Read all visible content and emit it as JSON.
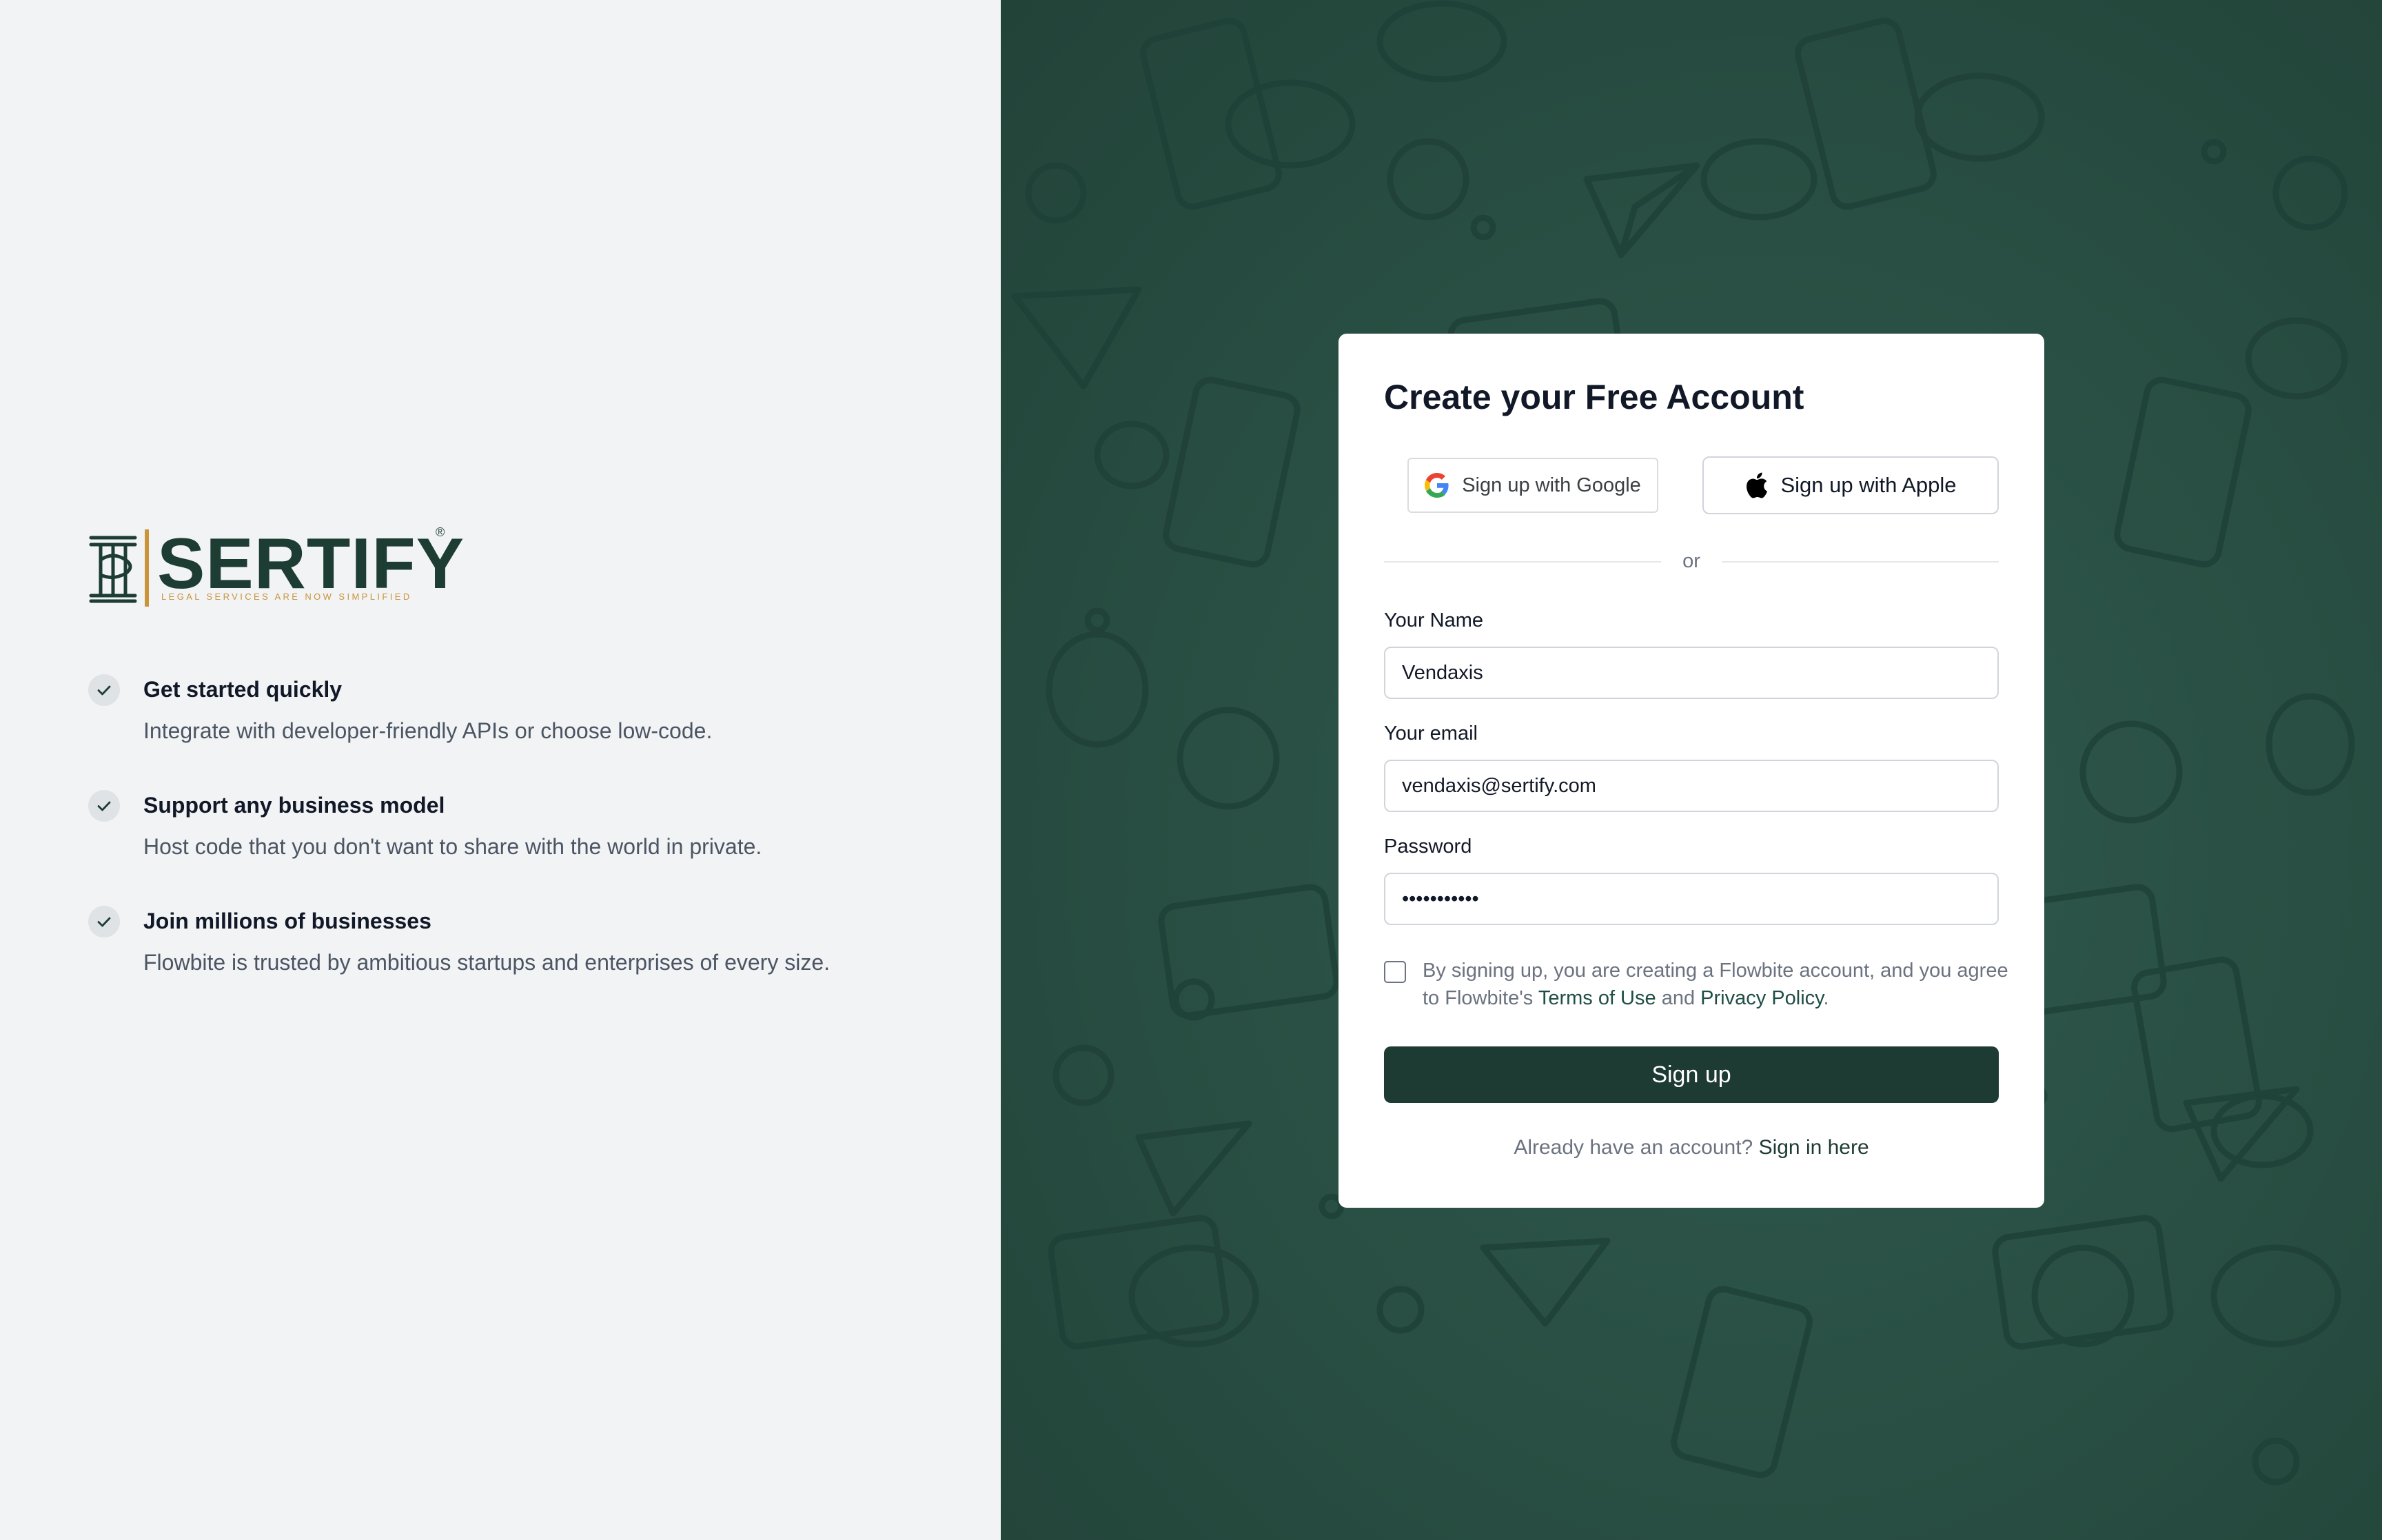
{
  "brand": {
    "name": "SERTIFY",
    "registered_mark": "®",
    "tagline": "LEGAL SERVICES ARE NOW SIMPLIFIED",
    "accent_color": "#c9943a",
    "primary_color": "#1d3d33"
  },
  "features": [
    {
      "icon": "check-icon",
      "title": "Get started quickly",
      "description": "Integrate with developer-friendly APIs or choose low-code."
    },
    {
      "icon": "check-icon",
      "title": "Support any business model",
      "description": "Host code that you don't want to share with the world in private."
    },
    {
      "icon": "check-icon",
      "title": "Join millions of businesses",
      "description": "Flowbite is trusted by ambitious startups and enterprises of every size."
    }
  ],
  "form": {
    "title": "Create your Free Account",
    "google_button": "Sign up with Google",
    "apple_button": "Sign up with Apple",
    "divider": "or",
    "name_label": "Your Name",
    "name_value": "Vendaxis",
    "email_label": "Your email",
    "email_value": "vendaxis@sertify.com",
    "password_label": "Password",
    "password_value": "•••••••••••",
    "terms_prefix": "By signing up, you are creating a Flowbite account, and you agree to Flowbite's",
    "terms_link": "Terms of Use",
    "terms_and": "and",
    "privacy_link": "Privacy Policy",
    "terms_suffix": ".",
    "terms_checked": false,
    "submit_button": "Sign up",
    "signin_prompt": "Already have an account?",
    "signin_link": "Sign in here"
  },
  "theme": {
    "panel_bg": "#2a5045",
    "button_bg": "#1d3a33",
    "left_bg": "#f2f3f5"
  }
}
